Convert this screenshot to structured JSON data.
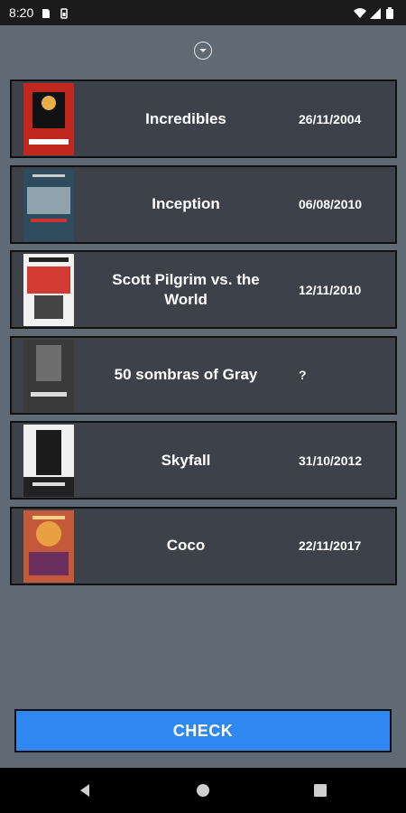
{
  "status_bar": {
    "time": "8:20",
    "icons": [
      "sim-card-icon",
      "battery-saver-icon",
      "wifi-icon",
      "signal-icon",
      "battery-icon"
    ]
  },
  "expand_icon": "chevron-down-circle-icon",
  "movies": [
    {
      "title": "Incredibles",
      "date": "26/11/2004",
      "poster_color": "#c0271f"
    },
    {
      "title": "Inception",
      "date": "06/08/2010",
      "poster_color": "#2f4c5e"
    },
    {
      "title": "Scott Pilgrim vs. the World",
      "date": "12/11/2010",
      "poster_color": "#d33a33"
    },
    {
      "title": "50 sombras of Gray",
      "date": "?",
      "poster_color": "#3a3a3a"
    },
    {
      "title": "Skyfall",
      "date": "31/10/2012",
      "poster_color": "#1c1c1c"
    },
    {
      "title": "Coco",
      "date": "22/11/2017",
      "poster_color": "#c45a3a"
    }
  ],
  "check_button": {
    "label": "CHECK"
  },
  "nav_bar": {
    "icons": [
      "back-icon",
      "home-icon",
      "recents-icon"
    ]
  }
}
